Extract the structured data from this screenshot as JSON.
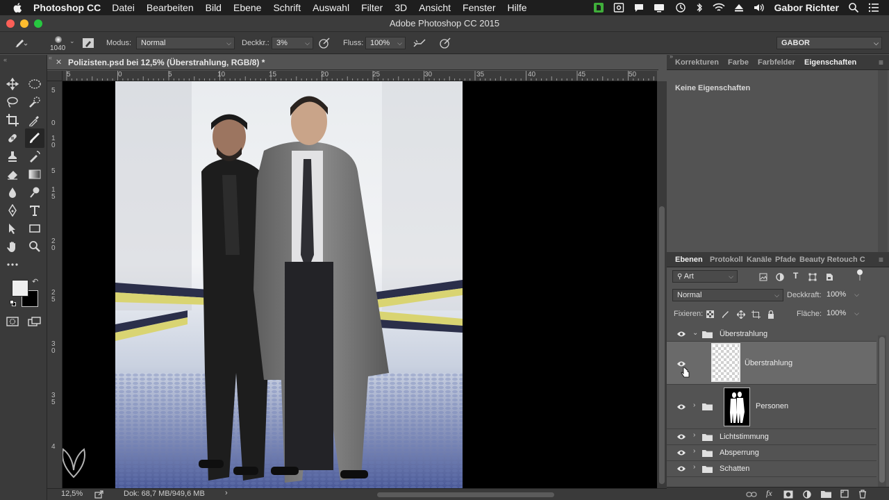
{
  "menubar": {
    "app": "Photoshop CC",
    "items": [
      "Datei",
      "Bearbeiten",
      "Bild",
      "Ebene",
      "Schrift",
      "Auswahl",
      "Filter",
      "3D",
      "Ansicht",
      "Fenster",
      "Hilfe"
    ],
    "user": "Gabor Richter"
  },
  "window": {
    "title": "Adobe Photoshop CC 2015"
  },
  "options": {
    "brush_size": "1040",
    "mode_label": "Modus:",
    "mode_value": "Normal",
    "opacity_label": "Deckkr.:",
    "opacity_value": "3%",
    "flow_label": "Fluss:",
    "flow_value": "100%",
    "workspace": "GABOR"
  },
  "document": {
    "tab_title": "Polizisten.psd bei 12,5% (Überstrahlung, RGB/8) *",
    "ruler_top": [
      "5",
      "0",
      "5",
      "10",
      "15",
      "20",
      "25",
      "30",
      "35",
      "40",
      "45",
      "50"
    ],
    "ruler_left": [
      "5",
      "0",
      "5",
      "1\n0",
      "1\n5",
      "2\n0",
      "2\n5",
      "3\n0",
      "3\n5",
      "4"
    ],
    "zoom": "12,5%",
    "doc_size": "Dok: 68,7 MB/949,6 MB"
  },
  "panels": {
    "top_tabs": [
      "Korrekturen",
      "Farbe",
      "Farbfelder",
      "Eigenschaften"
    ],
    "properties_text": "Keine Eigenschaften",
    "layer_tabs": [
      "Ebenen",
      "Protokoll",
      "Kanäle",
      "Pfade",
      "Beauty Retouch C"
    ],
    "filter_kind": "Art",
    "blend_mode": "Normal",
    "opacity_label": "Deckkraft:",
    "opacity_value": "100%",
    "lock_label": "Fixieren:",
    "fill_label": "Fläche:",
    "fill_value": "100%",
    "layers": [
      {
        "name": "Überstrahlung",
        "type": "group",
        "expanded": true
      },
      {
        "name": "Überstrahlung",
        "type": "layer",
        "selected": true
      },
      {
        "name": "Personen",
        "type": "group"
      },
      {
        "name": "Lichtstimmung",
        "type": "group"
      },
      {
        "name": "Absperrung",
        "type": "group"
      },
      {
        "name": "Schatten",
        "type": "group"
      }
    ]
  },
  "colors": {
    "menubar": "#1e1e1e",
    "panel": "#535353",
    "dark_panel": "#3a3a3a",
    "selected_layer": "#6a6a6a",
    "tape_yellow": "#d9d472",
    "tape_navy": "#2b2f4a"
  }
}
